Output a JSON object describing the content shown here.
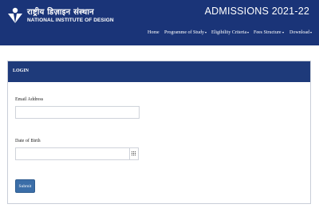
{
  "header": {
    "logo_hindi": "राष्ट्रीय डिज़ाइन संस्थान",
    "logo_english": "NATIONAL INSTITUTE OF DESIGN",
    "admissions_title": "ADMISSIONS 2021-22"
  },
  "nav": {
    "items": [
      {
        "label": "Home",
        "dropdown": false
      },
      {
        "label": "Programme of Study",
        "dropdown": true
      },
      {
        "label": "Eligibility Criteria",
        "dropdown": true
      },
      {
        "label": "Fees Structure",
        "dropdown": true
      },
      {
        "label": "Download",
        "dropdown": true
      }
    ]
  },
  "login": {
    "title": "LOGIN",
    "email_label": "Email Address",
    "email_value": "",
    "dob_label": "Date of Birth",
    "dob_value": "",
    "submit_label": "Submit"
  },
  "icons": {
    "logo": "nid-logo-icon",
    "calendar": "calendar-icon",
    "dropdown": "caret-down-icon"
  },
  "colors": {
    "header_bg": "#1a3478",
    "card_header_bg": "#1e3a7a",
    "button_bg": "#3b6ea8"
  }
}
